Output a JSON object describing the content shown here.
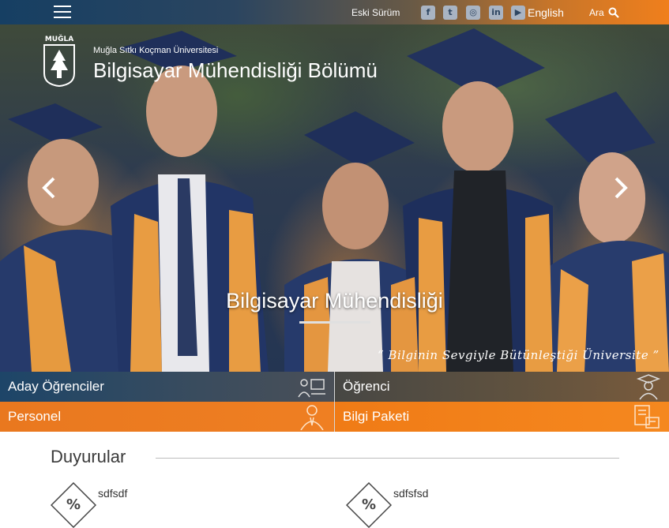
{
  "topbar": {
    "old_version": "Eski Sürüm",
    "social_icons": [
      "facebook-icon",
      "twitter-icon",
      "instagram-icon",
      "linkedin-icon",
      "youtube-icon"
    ],
    "language": "English",
    "search_label": "Ara",
    "gradient": [
      "#163f63",
      "#f07f1c"
    ]
  },
  "header": {
    "logo_text": "MUĞLA",
    "university": "Muğla Sıtkı Koçman Üniversitesi",
    "department": "Bilgisayar Mühendisliği Bölümü"
  },
  "slider": {
    "caption": "Bilgisayar Mühendisliği",
    "slogan": "“ Bilginin Sevgiyle Bütünleştiği Üniversite ”"
  },
  "quick_links": [
    {
      "label": "Aday Öğrenciler",
      "icon": "candidate-students-icon"
    },
    {
      "label": "Öğrenci",
      "icon": "graduate-student-icon"
    },
    {
      "label": "Personel",
      "icon": "staff-person-icon"
    },
    {
      "label": "Bilgi Paketi",
      "icon": "info-package-icon"
    }
  ],
  "announcements": {
    "heading": "Duyurular",
    "items": [
      {
        "title": "sdfsdf",
        "badge": "%"
      },
      {
        "title": "sdfsfsd",
        "badge": "%"
      }
    ]
  },
  "colors": {
    "navy": "#1d4568",
    "orange": "#f07f1c"
  }
}
